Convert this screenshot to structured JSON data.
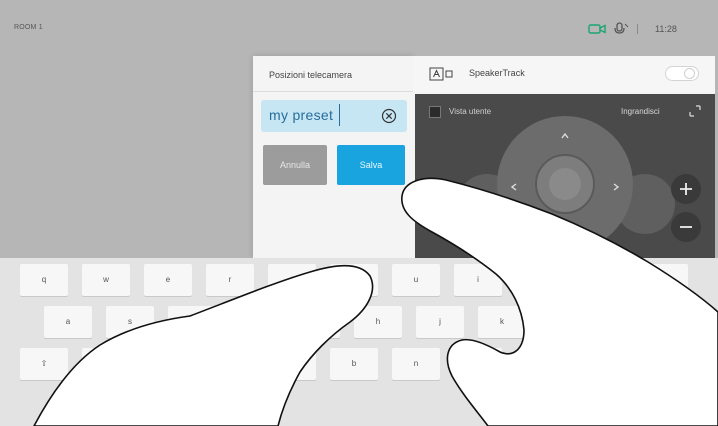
{
  "status_bar": {
    "device_name": "ROOM 1",
    "time": "11:28",
    "icons": [
      "camera-icon",
      "microphone-icon"
    ],
    "camera_icon_color": "#1ba672"
  },
  "camera_panel": {
    "title": "Posizioni telecamera",
    "preset_input": {
      "value": "my preset"
    },
    "cancel_label": "Annulla",
    "save_label": "Salva"
  },
  "control_panel": {
    "speakertrack_label": "SpeakerTrack",
    "speakertrack_enabled": false,
    "self_view_label": "Vista utente",
    "zoom_label": "Ingrandisci"
  },
  "keyboard": {
    "rows": [
      [
        "q",
        "w",
        "e",
        "r",
        "t",
        "y",
        "u",
        "i",
        "o",
        "p",
        "⌫"
      ],
      [
        "a",
        "s",
        "d",
        "f",
        "g",
        "h",
        "j",
        "k",
        "l"
      ],
      [
        "⇧",
        "z",
        "x",
        "c",
        "v",
        "b",
        "n",
        "m",
        ",",
        ".",
        "⇧"
      ]
    ]
  },
  "colors": {
    "accent": "#19a4e0",
    "input_fill": "#c7e6f4",
    "input_text": "#266d9b",
    "cancel_fill": "#9c9c9c",
    "camera_view": "#4a4a4a"
  }
}
